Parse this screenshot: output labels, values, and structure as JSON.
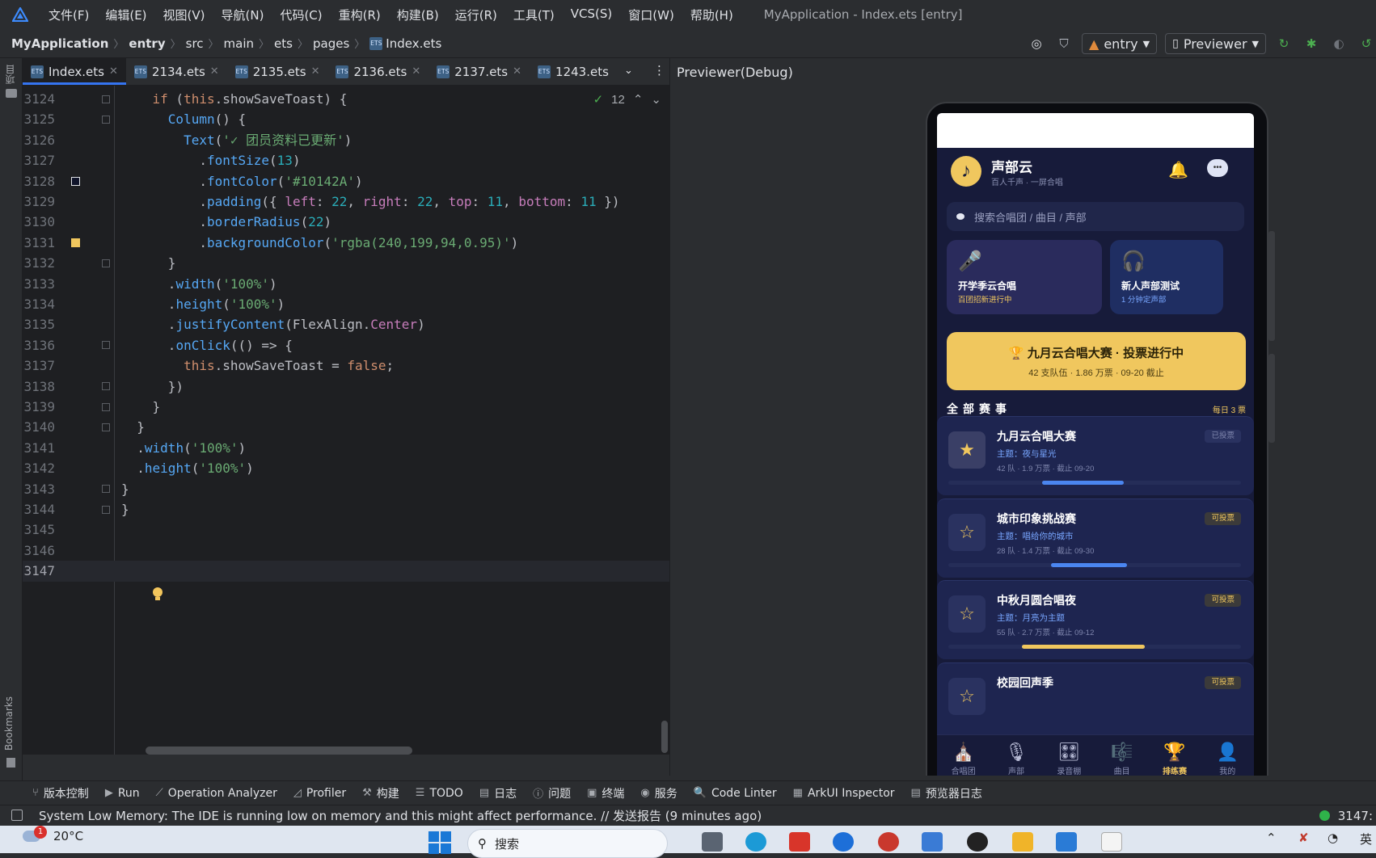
{
  "menubar": {
    "items": [
      "文件(F)",
      "编辑(E)",
      "视图(V)",
      "导航(N)",
      "代码(C)",
      "重构(R)",
      "构建(B)",
      "运行(R)",
      "工具(T)",
      "VCS(S)",
      "窗口(W)",
      "帮助(H)"
    ],
    "window_title": "MyApplication - Index.ets [entry]"
  },
  "navbar": {
    "crumbs": [
      "MyApplication",
      "entry",
      "src",
      "main",
      "ets",
      "pages",
      "Index.ets"
    ],
    "module_select": "entry",
    "run_target": "Previewer"
  },
  "left_strip": {
    "project": "项目",
    "bookmarks": "Bookmarks",
    "structure": "结构"
  },
  "tabs": [
    {
      "label": "Index.ets",
      "active": true
    },
    {
      "label": "2134.ets",
      "active": false
    },
    {
      "label": "2135.ets",
      "active": false
    },
    {
      "label": "2136.ets",
      "active": false
    },
    {
      "label": "2137.ets",
      "active": false
    },
    {
      "label": "1243.ets",
      "active": false
    }
  ],
  "editor": {
    "inspection_count": "12",
    "lines": [
      {
        "n": "3124",
        "html": "    <span class='k'>if</span> (<span class='k'>this</span>.showSaveToast) {"
      },
      {
        "n": "3125",
        "html": "      <span class='fn'>Column</span>() {"
      },
      {
        "n": "3126",
        "html": "        <span class='fn'>Text</span>(<span class='s'>'✓ 团员资料已更新'</span>)"
      },
      {
        "n": "3127",
        "html": "          .<span class='fn'>fontSize</span>(<span class='n'>13</span>)"
      },
      {
        "n": "3128",
        "html": "          .<span class='fn'>fontColor</span>(<span class='s'>'#10142A'</span>)"
      },
      {
        "n": "3129",
        "html": "          .<span class='fn'>padding</span>({ <span class='me'>left</span>: <span class='n'>22</span>, <span class='me'>right</span>: <span class='n'>22</span>, <span class='me'>top</span>: <span class='n'>11</span>, <span class='me'>bottom</span>: <span class='n'>11</span> })"
      },
      {
        "n": "3130",
        "html": "          .<span class='fn'>borderRadius</span>(<span class='n'>22</span>)"
      },
      {
        "n": "3131",
        "html": "          .<span class='fn'>backgroundColor</span>(<span class='s'>'rgba(240,199,94,0.95)'</span>)"
      },
      {
        "n": "3132",
        "html": "      }"
      },
      {
        "n": "3133",
        "html": "      .<span class='fn'>width</span>(<span class='s'>'100%'</span>)"
      },
      {
        "n": "3134",
        "html": "      .<span class='fn'>height</span>(<span class='s'>'100%'</span>)"
      },
      {
        "n": "3135",
        "html": "      .<span class='fn'>justifyContent</span>(FlexAlign.<span class='me'>Center</span>)"
      },
      {
        "n": "3136",
        "html": "      .<span class='fn'>onClick</span>(() => {"
      },
      {
        "n": "3137",
        "html": "        <span class='k'>this</span>.showSaveToast = <span class='k'>false</span>;"
      },
      {
        "n": "3138",
        "html": "      })"
      },
      {
        "n": "3139",
        "html": "    }"
      },
      {
        "n": "3140",
        "html": "  }"
      },
      {
        "n": "3141",
        "html": "  .<span class='fn'>width</span>(<span class='s'>'100%'</span>)"
      },
      {
        "n": "3142",
        "html": "  .<span class='fn'>height</span>(<span class='s'>'100%'</span>)"
      },
      {
        "n": "3143",
        "html": "}"
      },
      {
        "n": "3144",
        "html": "}"
      },
      {
        "n": "3145",
        "html": ""
      },
      {
        "n": "3146",
        "html": ""
      },
      {
        "n": "3147",
        "html": ""
      }
    ]
  },
  "preview": {
    "title": "Previewer(Debug)",
    "app": {
      "name": "声部云",
      "tagline": "百人千声 · 一屏合唱",
      "search_placeholder": "搜索合唱团 / 曲目 / 声部",
      "quick_cards": [
        {
          "title": "开学季云合唱",
          "sub": "百团招新进行中",
          "icon": "microphone-icon",
          "sub_color": "#f0c75e",
          "bg": "#2a2b5c"
        },
        {
          "title": "新人声部测试",
          "sub": "1 分钟定声部",
          "icon": "headphones-icon",
          "sub_color": "#78a6ff",
          "bg": "#1f2e62"
        }
      ],
      "banner_title": "🏆 九月云合唱大赛 · 投票进行中",
      "banner_sub": "42 支队伍 · 1.86 万票 · 09-20 截止",
      "section_title": "全部赛事",
      "votes_per_day": "每日 3 票",
      "contests": [
        {
          "title": "九月云合唱大赛",
          "theme": "主题：夜与星光",
          "meta": "42 队 · 1.9 万票 · 截止 09-20",
          "badge": "已投票",
          "voted": true,
          "progress": 0.28,
          "offset": 0.32,
          "bar_color": "#4b86f0"
        },
        {
          "title": "城市印象挑战赛",
          "theme": "主题：唱给你的城市",
          "meta": "28 队 · 1.4 万票 · 截止 09-30",
          "badge": "可投票",
          "voted": false,
          "progress": 0.26,
          "offset": 0.35,
          "bar_color": "#4b86f0"
        },
        {
          "title": "中秋月圆合唱夜",
          "theme": "主题：月亮为主题",
          "meta": "55 队 · 2.7 万票 · 截止 09-12",
          "badge": "可投票",
          "voted": false,
          "progress": 0.42,
          "offset": 0.25,
          "bar_color": "#f0c75e"
        },
        {
          "title": "校园回声季",
          "theme": "",
          "meta": "",
          "badge": "可投票",
          "voted": false,
          "progress": 0,
          "offset": 0,
          "bar_color": "#4b86f0"
        }
      ],
      "tabbar": [
        {
          "label": "合唱团",
          "icon": "church-icon",
          "glyph": "⛪",
          "active": false
        },
        {
          "label": "声部",
          "icon": "mic-icon",
          "glyph": "🎙",
          "active": false
        },
        {
          "label": "录音棚",
          "icon": "mixer-icon",
          "glyph": "🎛",
          "active": false
        },
        {
          "label": "曲目",
          "icon": "score-icon",
          "glyph": "🎼",
          "active": false
        },
        {
          "label": "排练赛",
          "icon": "trophy-icon",
          "glyph": "🏆",
          "active": true
        },
        {
          "label": "我的",
          "icon": "user-icon",
          "glyph": "👤",
          "active": false
        }
      ]
    }
  },
  "tool_windows": [
    {
      "label": "版本控制",
      "icon": "branch-icon",
      "glyph": "⑂"
    },
    {
      "label": "Run",
      "icon": "run-icon",
      "glyph": "▶"
    },
    {
      "label": "Operation Analyzer",
      "icon": "analyzer-icon",
      "glyph": "⟋"
    },
    {
      "label": "Profiler",
      "icon": "profiler-icon",
      "glyph": "◿"
    },
    {
      "label": "构建",
      "icon": "hammer-icon",
      "glyph": "⚒"
    },
    {
      "label": "TODO",
      "icon": "todo-icon",
      "glyph": "☰"
    },
    {
      "label": "日志",
      "icon": "log-icon",
      "glyph": "▤"
    },
    {
      "label": "问题",
      "icon": "problems-icon",
      "glyph": "ⓘ"
    },
    {
      "label": "终端",
      "icon": "terminal-icon",
      "glyph": "▣"
    },
    {
      "label": "服务",
      "icon": "services-icon",
      "glyph": "◉"
    },
    {
      "label": "Code Linter",
      "icon": "linter-icon",
      "glyph": "🔍"
    },
    {
      "label": "ArkUI Inspector",
      "icon": "inspector-icon",
      "glyph": "▦"
    },
    {
      "label": "预览器日志",
      "icon": "preview-log-icon",
      "glyph": "▤"
    }
  ],
  "status": {
    "message": "System Low Memory: The IDE is running low on memory and this might affect performance. // 发送报告 (9 minutes ago)",
    "position": "3147:"
  },
  "taskbar": {
    "temperature": "20°C",
    "notification_count": "1",
    "search_placeholder": "搜索",
    "ime": "英"
  }
}
